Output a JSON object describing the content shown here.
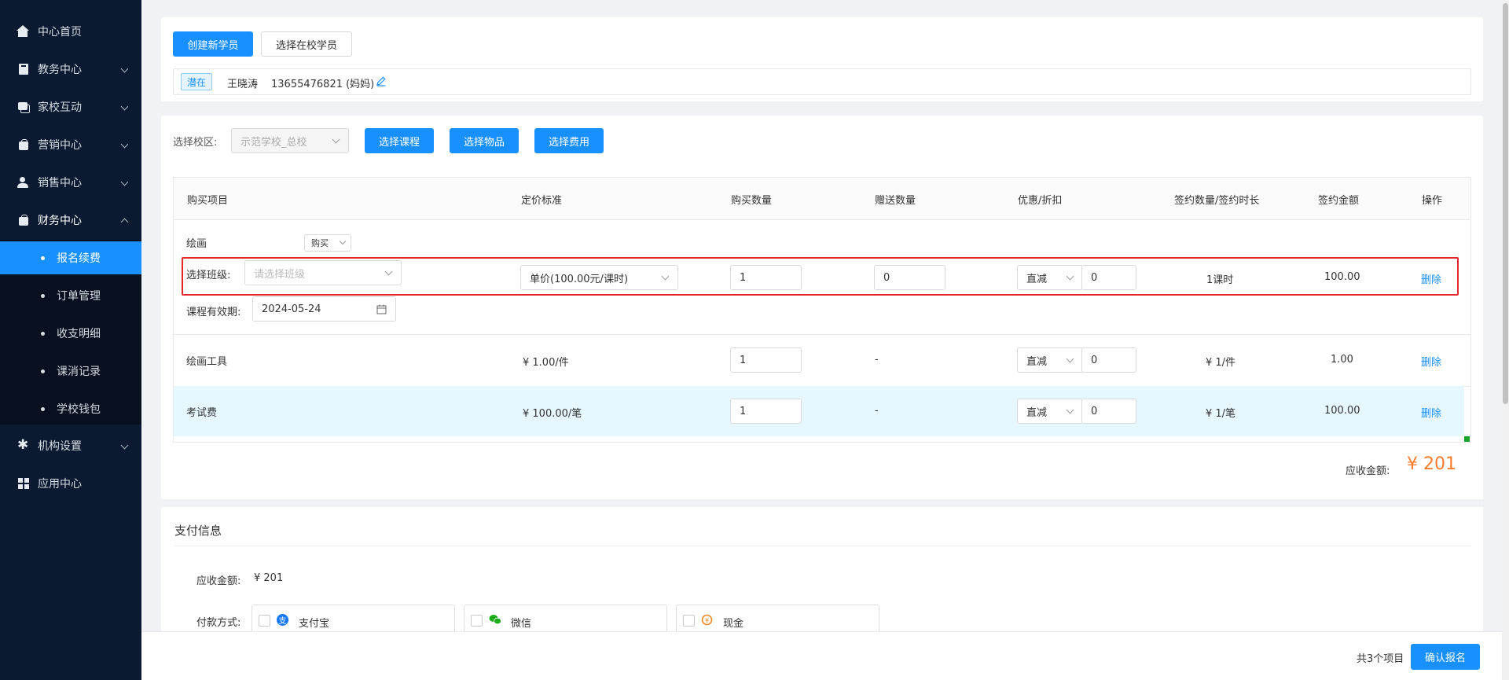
{
  "sidebar": {
    "items": [
      {
        "label": "中心首页",
        "icon": "home-icon"
      },
      {
        "label": "教务中心",
        "icon": "book-icon"
      },
      {
        "label": "家校互动",
        "icon": "chat-icon"
      },
      {
        "label": "营销中心",
        "icon": "bag-icon"
      },
      {
        "label": "销售中心",
        "icon": "user-icon"
      },
      {
        "label": "财务中心",
        "icon": "bag-icon"
      },
      {
        "label": "机构设置",
        "icon": "gear-icon"
      },
      {
        "label": "应用中心",
        "icon": "grid-icon"
      }
    ],
    "finance_sub": [
      "报名续费",
      "订单管理",
      "收支明细",
      "课消记录",
      "学校钱包"
    ]
  },
  "student": {
    "create_btn": "创建新学员",
    "select_btn": "选择在校学员",
    "tag": "潜在",
    "name": "王晓涛",
    "phone": "13655476821 (妈妈)"
  },
  "purchase": {
    "campus_label": "选择校区:",
    "campus_value": "示范学校_总校",
    "btn_course": "选择课程",
    "btn_goods": "选择物品",
    "btn_fee": "选择费用",
    "headers": [
      "购买项目",
      "定价标准",
      "购买数量",
      "赠送数量",
      "优惠/折扣",
      "签约数量/签约时长",
      "签约金额",
      "操作"
    ],
    "course": {
      "name": "绘画",
      "mode": "购买",
      "class_label": "选择班级:",
      "class_placeholder": "请选择班级",
      "price": "单价(100.00元/课时)",
      "qty": "1",
      "gift": "0",
      "discount_type": "直减",
      "discount": "0",
      "sign_qty": "1课时",
      "amount": "100.00",
      "op": "删除",
      "valid_label": "课程有效期:",
      "valid_date": "2024-05-24"
    },
    "goods": {
      "name": "绘画工具",
      "price": "¥ 1.00/件",
      "qty": "1",
      "gift": "-",
      "discount_type": "直减",
      "discount": "0",
      "sign_qty": "¥ 1/件",
      "amount": "1.00",
      "op": "删除"
    },
    "fee": {
      "name": "考试费",
      "price": "¥ 100.00/笔",
      "qty": "1",
      "gift": "-",
      "discount_type": "直减",
      "discount": "0",
      "sign_qty": "¥ 1/笔",
      "amount": "100.00",
      "op": "删除"
    },
    "receivable_label": "应收金额:",
    "receivable_value": "¥ 201"
  },
  "payment": {
    "title": "支付信息",
    "receivable_label": "应收金额:",
    "receivable_value": "¥ 201",
    "method_label": "付款方式:",
    "methods": [
      "支付宝",
      "微信",
      "现金"
    ]
  },
  "footer": {
    "count": "共3个项目",
    "confirm_btn": "确认报名"
  },
  "colors": {
    "primary": "#1890ff",
    "sidebar": "#0b1a30",
    "price": "#fa7d2d",
    "highlight": "#e5262b"
  }
}
